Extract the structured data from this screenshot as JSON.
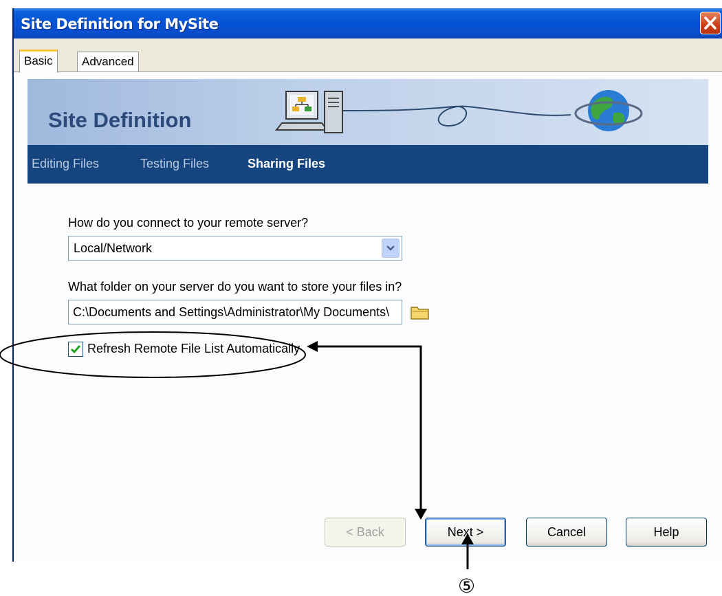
{
  "window": {
    "title": "Site Definition for MySite"
  },
  "tabs": [
    {
      "label": "Basic",
      "active": true
    },
    {
      "label": "Advanced",
      "active": false
    }
  ],
  "banner": {
    "title": "Site Definition"
  },
  "steps": [
    {
      "label": "Editing Files",
      "active": false
    },
    {
      "label": "Testing Files",
      "active": false
    },
    {
      "label": "Sharing Files",
      "active": true
    }
  ],
  "connection": {
    "question": "How do you connect to your remote server?",
    "selected": "Local/Network"
  },
  "folder": {
    "question": "What folder on your server do you want to store your files in?",
    "value": "C:\\Documents and Settings\\Administrator\\My Documents\\"
  },
  "refresh": {
    "label": "Refresh Remote File List Automatically",
    "checked": true
  },
  "buttons": {
    "back": "< Back",
    "next": "Next >",
    "cancel": "Cancel",
    "help": "Help"
  },
  "annotation": {
    "step_marker": "⑤"
  },
  "colors": {
    "titlebar": "#0553d6",
    "navbar": "#15447e",
    "tab_highlight": "#ffc83c"
  }
}
